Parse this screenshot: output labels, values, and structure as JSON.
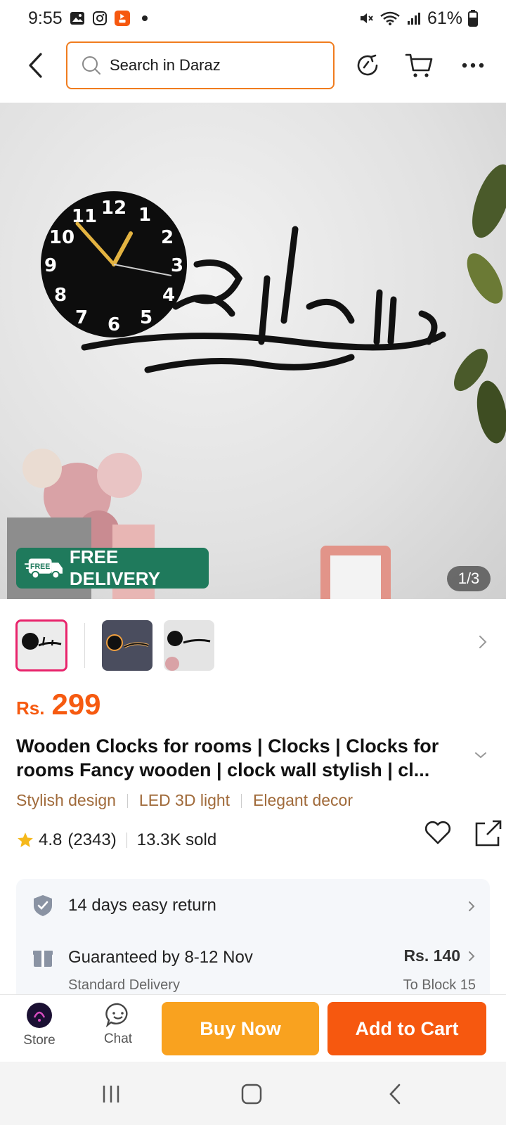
{
  "status": {
    "time": "9:55",
    "battery": "61%"
  },
  "header": {
    "search_placeholder": "Search in Daraz"
  },
  "gallery": {
    "page_indicator": "1/3",
    "free_delivery_badge": "FREE DELIVERY",
    "free_tag": "FREE"
  },
  "product": {
    "currency": "Rs.",
    "price": "299",
    "title": "Wooden Clocks for rooms | Clocks | Clocks for rooms Fancy wooden | clock wall stylish | cl...",
    "tags": [
      "Stylish design",
      "LED 3D light",
      "Elegant decor"
    ],
    "rating": "4.8",
    "reviews": "(2343)",
    "sold": "13.3K sold"
  },
  "services": {
    "return_text": "14 days easy return",
    "delivery_text": "Guaranteed by 8-12 Nov",
    "delivery_type": "Standard Delivery",
    "delivery_fee": "Rs. 140",
    "delivery_location": "To Block 15"
  },
  "bottom_bar": {
    "store_label": "Store",
    "chat_label": "Chat",
    "buy_now_label": "Buy Now",
    "add_to_cart_label": "Add to Cart"
  },
  "colors": {
    "accent": "#f6580f",
    "buy": "#f9a21f",
    "badge": "#1f7a5c"
  }
}
